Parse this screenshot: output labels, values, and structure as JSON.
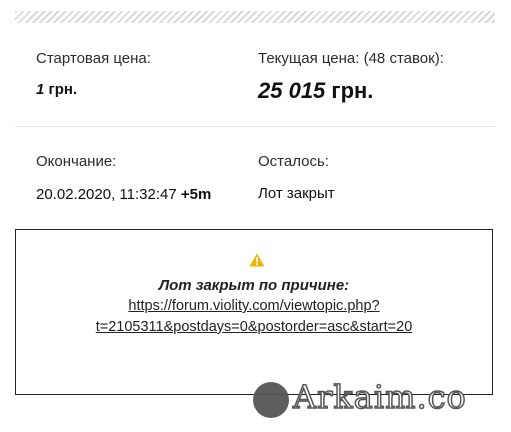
{
  "auction": {
    "start_price_label": "Стартовая цена:",
    "start_price_value": "1",
    "start_price_currency": "грн.",
    "current_price_label": "Текущая цена: (48 ставок):",
    "current_price_value": "25 015",
    "current_price_currency": "грн.",
    "end_label": "Окончание:",
    "end_date": "20.02.2020, 11:32:47",
    "end_extension": "+5m",
    "remaining_label": "Осталось:",
    "remaining_value": "Лот закрыт"
  },
  "notice": {
    "icon": "warning-icon",
    "title": "Лот закрыт по причине:",
    "link_line1": "https://forum.violity.com/viewtopic.php?",
    "link_line2": "t=2105311&postdays=0&postorder=asc&start=20"
  },
  "watermark": {
    "text": "Arkaim.co"
  },
  "colors": {
    "warning": "#f0b400",
    "border": "#222222",
    "text": "#222222"
  }
}
